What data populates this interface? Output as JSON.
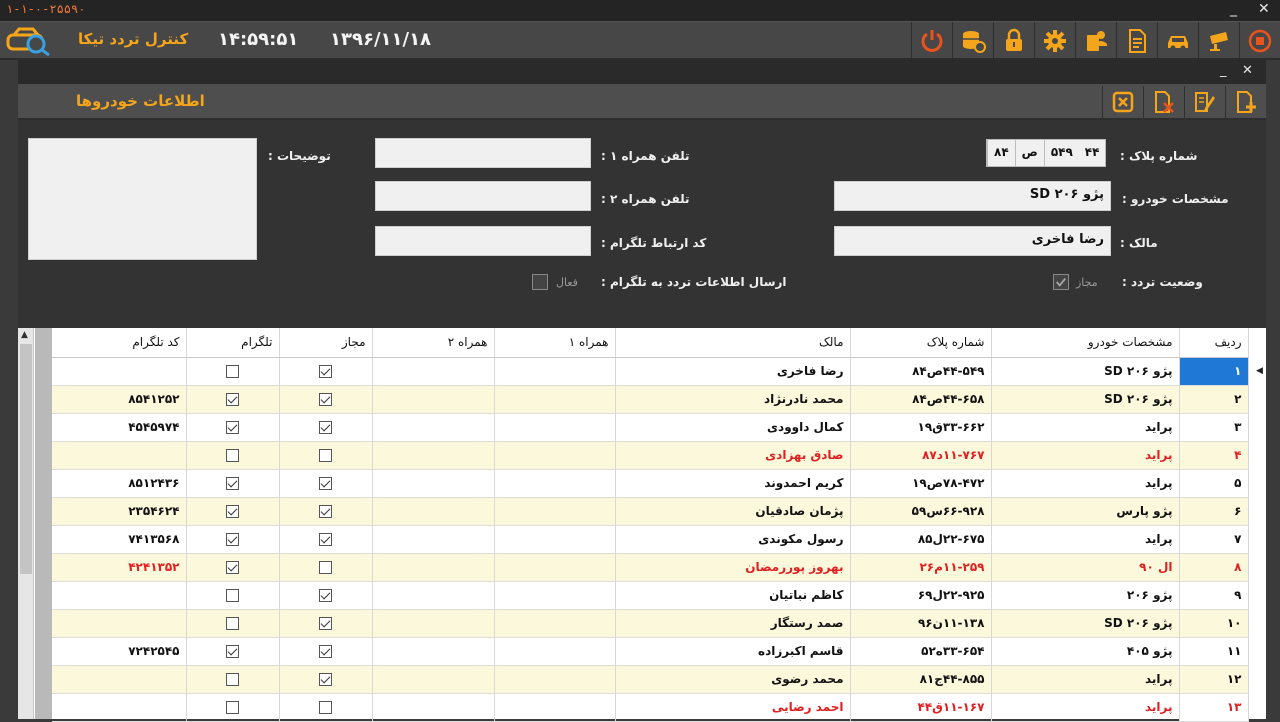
{
  "window": {
    "serial": "۱-۱-۰-۲۵۵۹۰",
    "minimize": "_",
    "close": "✕"
  },
  "app": {
    "title": "کنترل تردد تیکا",
    "time": "۱۴:۵۹:۵۱",
    "date": "۱۳۹۶/۱۱/۱۸",
    "accent": "#f4a51c"
  },
  "toolbar_icons": [
    "power-icon",
    "database-icon",
    "lock-icon",
    "gear-icon",
    "user-card-icon",
    "document-icon",
    "car-icon",
    "camera-icon",
    "record-icon"
  ],
  "child_window": {
    "minimize": "_",
    "close": "✕"
  },
  "form": {
    "title": "اطلاعات خودروها",
    "tool_icons": [
      "close-box-icon",
      "delete-file-icon",
      "edit-icon",
      "add-file-icon"
    ],
    "plate_label": "شماره پلاک :",
    "plate_parts": [
      "۴۴",
      "۵۴۹",
      "ص",
      "۸۴"
    ],
    "vehicle_spec_label": "مشخصات خودرو :",
    "vehicle_spec_value": "پژو ۲۰۶ SD",
    "owner_label": "مالک :",
    "owner_value": "رضا فاخری",
    "traffic_status_label": "وضعیت تردد :",
    "allowed_label": "مجاز",
    "allowed_checked": true,
    "phone1_label": "تلفن همراه ۱ :",
    "phone1_value": "",
    "phone2_label": "تلفن همراه ۲ :",
    "phone2_value": "",
    "telegram_code_label": "کد ارتباط تلگرام :",
    "telegram_code_value": "",
    "telegram_send_label": "ارسال اطلاعات تردد به تلگرام :",
    "active_label": "فعال",
    "active_checked": false,
    "notes_label": "توضیحات :",
    "notes_value": ""
  },
  "grid": {
    "columns": [
      "ردیف",
      "مشخصات خودرو",
      "شماره پلاک",
      "مالک",
      "همراه ۱",
      "همراه ۲",
      "مجاز",
      "تلگرام",
      "کد تلگرام"
    ],
    "rows": [
      {
        "num": "۱",
        "spec": "پژو ۲۰۶ SD",
        "plate": "۴۴-۵۴۹ص۸۴",
        "owner": "رضا فاخری",
        "m1": "",
        "m2": "",
        "allowed": true,
        "telegram": false,
        "code": "",
        "red": false,
        "selected": true
      },
      {
        "num": "۲",
        "spec": "پژو ۲۰۶ SD",
        "plate": "۴۴-۶۵۸ص۸۴",
        "owner": "محمد نادرنژاد",
        "m1": "",
        "m2": "",
        "allowed": true,
        "telegram": true,
        "code": "۸۵۴۱۲۵۲",
        "red": false,
        "selected": false
      },
      {
        "num": "۳",
        "spec": "پراید",
        "plate": "۳۳-۶۶۲ق۱۹",
        "owner": "کمال داوودی",
        "m1": "",
        "m2": "",
        "allowed": true,
        "telegram": true,
        "code": "۴۵۴۵۹۷۴",
        "red": false,
        "selected": false
      },
      {
        "num": "۴",
        "spec": "پراید",
        "plate": "۱۱-۷۶۷د۸۷",
        "owner": "صادق بهزادی",
        "m1": "",
        "m2": "",
        "allowed": false,
        "telegram": false,
        "code": "",
        "red": true,
        "selected": false
      },
      {
        "num": "۵",
        "spec": "پراید",
        "plate": "۷۸-۴۷۲ص۱۹",
        "owner": "کریم احمدوند",
        "m1": "",
        "m2": "",
        "allowed": true,
        "telegram": true,
        "code": "۸۵۱۲۴۳۶",
        "red": false,
        "selected": false
      },
      {
        "num": "۶",
        "spec": "پژو پارس",
        "plate": "۶۶-۹۲۸س۵۹",
        "owner": "پژمان صادقیان",
        "m1": "",
        "m2": "",
        "allowed": true,
        "telegram": true,
        "code": "۲۳۵۴۶۲۴",
        "red": false,
        "selected": false
      },
      {
        "num": "۷",
        "spec": "پراید",
        "plate": "۲۲-۶۷۵ل۸۵",
        "owner": "رسول مکوندی",
        "m1": "",
        "m2": "",
        "allowed": true,
        "telegram": true,
        "code": "۷۴۱۳۵۶۸",
        "red": false,
        "selected": false
      },
      {
        "num": "۸",
        "spec": "ال ۹۰",
        "plate": "۱۱-۲۵۹م۲۶",
        "owner": "بهروز پوررمضان",
        "m1": "",
        "m2": "",
        "allowed": false,
        "telegram": true,
        "code": "۴۲۴۱۳۵۲",
        "red": true,
        "selected": false
      },
      {
        "num": "۹",
        "spec": "پژو ۲۰۶",
        "plate": "۲۲-۹۲۵ل۶۹",
        "owner": "کاظم نباتیان",
        "m1": "",
        "m2": "",
        "allowed": true,
        "telegram": false,
        "code": "",
        "red": false,
        "selected": false
      },
      {
        "num": "۱۰",
        "spec": "پژو ۲۰۶ SD",
        "plate": "۱۱-۱۳۸ن۹۶",
        "owner": "صمد رستگار",
        "m1": "",
        "m2": "",
        "allowed": true,
        "telegram": false,
        "code": "",
        "red": false,
        "selected": false
      },
      {
        "num": "۱۱",
        "spec": "پژو ۴۰۵",
        "plate": "۳۳-۶۵۴ه۵۲",
        "owner": "قاسم اکبرزاده",
        "m1": "",
        "m2": "",
        "allowed": true,
        "telegram": true,
        "code": "۷۲۴۲۵۴۵",
        "red": false,
        "selected": false
      },
      {
        "num": "۱۲",
        "spec": "پراید",
        "plate": "۴۴-۸۵۵ج۸۱",
        "owner": "محمد رضوی",
        "m1": "",
        "m2": "",
        "allowed": true,
        "telegram": false,
        "code": "",
        "red": false,
        "selected": false
      },
      {
        "num": "۱۳",
        "spec": "پراید",
        "plate": "۱۱-۱۶۷ق۴۴",
        "owner": "احمد رضایی",
        "m1": "",
        "m2": "",
        "allowed": false,
        "telegram": false,
        "code": "",
        "red": true,
        "selected": false
      }
    ]
  }
}
